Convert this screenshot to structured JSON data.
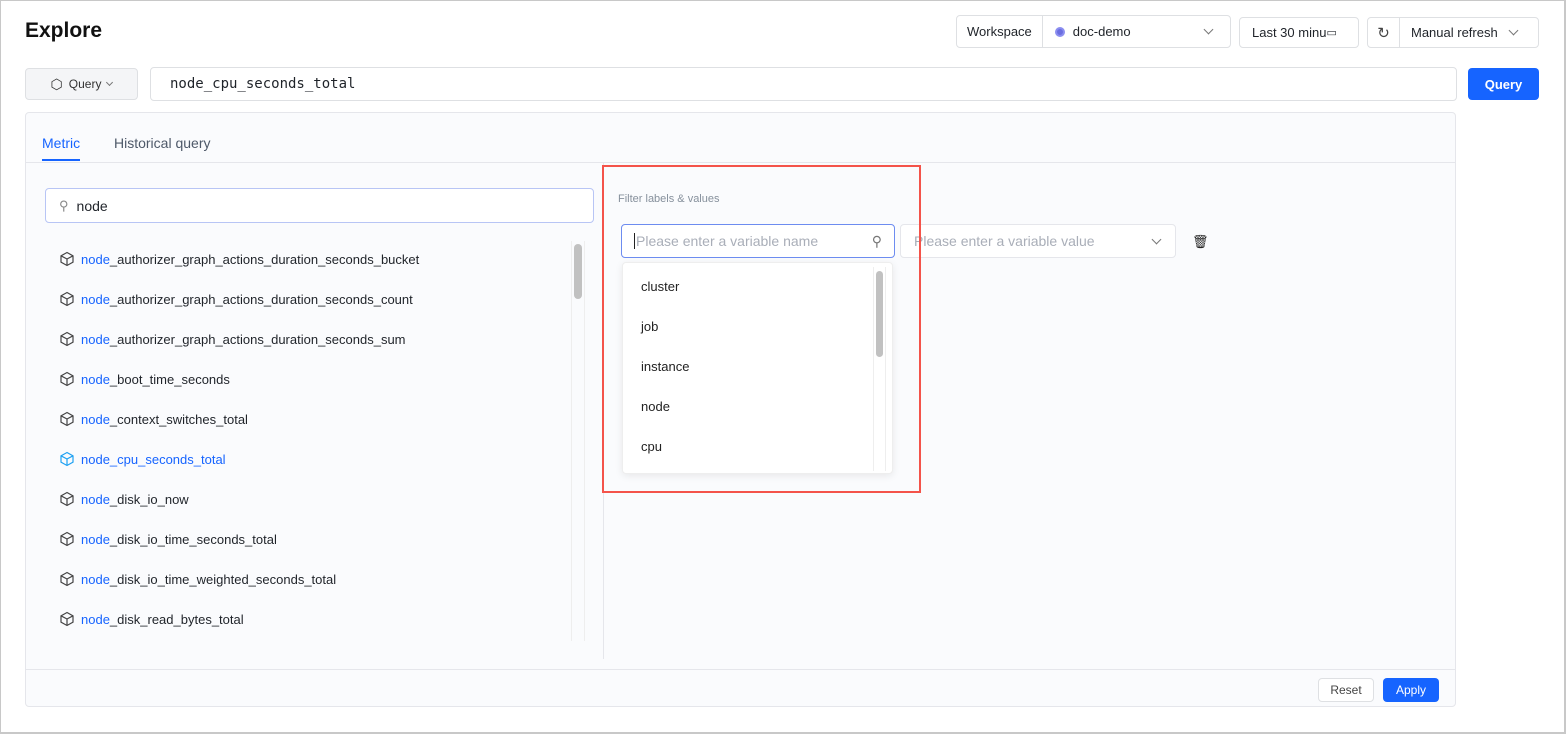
{
  "header": {
    "title": "Explore",
    "workspace_label": "Workspace",
    "workspace_value": "doc-demo",
    "time_range": "Last 30 minu",
    "refresh": "Manual refresh"
  },
  "query": {
    "mode": "Query",
    "value": "node_cpu_seconds_total",
    "button": "Query"
  },
  "tabs": [
    {
      "label": "Metric",
      "active": true
    },
    {
      "label": "Historical query",
      "active": false
    }
  ],
  "metric_search": {
    "value": "node"
  },
  "metrics": [
    {
      "match": "node",
      "rest": "_authorizer_graph_actions_duration_seconds_bucket"
    },
    {
      "match": "node",
      "rest": "_authorizer_graph_actions_duration_seconds_count"
    },
    {
      "match": "node",
      "rest": "_authorizer_graph_actions_duration_seconds_sum"
    },
    {
      "match": "node",
      "rest": "_boot_time_seconds"
    },
    {
      "match": "node",
      "rest": "_context_switches_total"
    },
    {
      "match": "node",
      "rest": "_cpu_seconds_total",
      "selected": true
    },
    {
      "match": "node",
      "rest": "_disk_io_now"
    },
    {
      "match": "node",
      "rest": "_disk_io_time_seconds_total"
    },
    {
      "match": "node",
      "rest": "_disk_io_time_weighted_seconds_total"
    },
    {
      "match": "node",
      "rest": "_disk_read_bytes_total"
    }
  ],
  "filter": {
    "label": "Filter labels & values",
    "name_placeholder": "Please enter a variable name",
    "value_placeholder": "Please enter a variable value",
    "options": [
      "cluster",
      "job",
      "instance",
      "node",
      "cpu"
    ]
  },
  "footer": {
    "reset": "Reset",
    "apply": "Apply"
  },
  "colors": {
    "accent": "#1664ff",
    "highlight_box": "#f4534a"
  }
}
